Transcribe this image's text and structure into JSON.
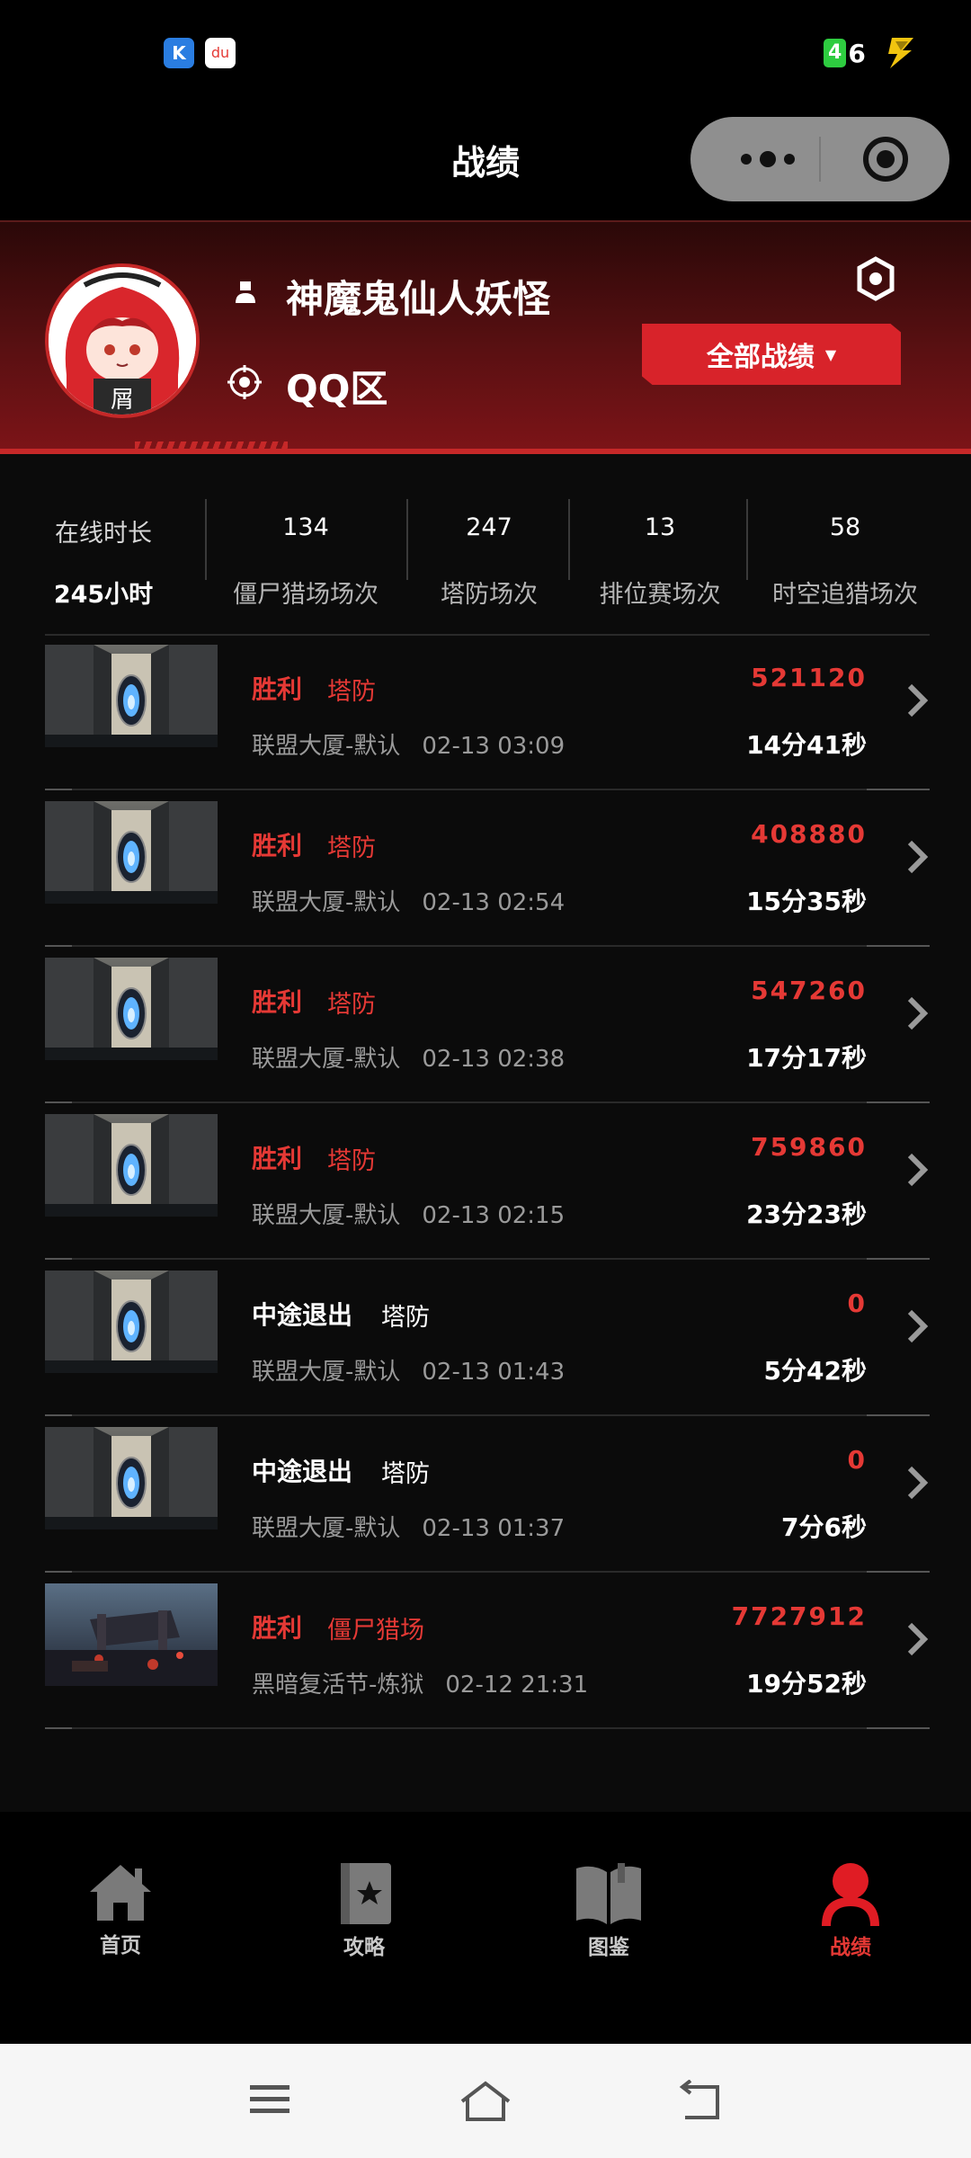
{
  "status_bar": {
    "network_badge": "4",
    "signal_text": "6",
    "app_icons": [
      "k-app-icon",
      "du-app-icon"
    ],
    "app1_text": "K",
    "app2_text": "du"
  },
  "header": {
    "title": "战绩"
  },
  "profile": {
    "username": "神魔鬼仙人妖怪",
    "zone": "QQ区",
    "filter_label": "全部战绩",
    "filter_arrow": "▼"
  },
  "stats": [
    {
      "value": "在线时长",
      "label": "245小时"
    },
    {
      "value": "134",
      "label": "僵尸猎场场次"
    },
    {
      "value": "247",
      "label": "塔防场次"
    },
    {
      "value": "13",
      "label": "排位赛场次"
    },
    {
      "value": "58",
      "label": "时空追猎场次"
    }
  ],
  "records": [
    {
      "result": "胜利",
      "mode": "塔防",
      "map": "联盟大厦-默认",
      "time": "02-13 03:09",
      "score": "521120",
      "duration": "14分41秒",
      "status": "win",
      "scene": "tower"
    },
    {
      "result": "胜利",
      "mode": "塔防",
      "map": "联盟大厦-默认",
      "time": "02-13 02:54",
      "score": "408880",
      "duration": "15分35秒",
      "status": "win",
      "scene": "tower"
    },
    {
      "result": "胜利",
      "mode": "塔防",
      "map": "联盟大厦-默认",
      "time": "02-13 02:38",
      "score": "547260",
      "duration": "17分17秒",
      "status": "win",
      "scene": "tower"
    },
    {
      "result": "胜利",
      "mode": "塔防",
      "map": "联盟大厦-默认",
      "time": "02-13 02:15",
      "score": "759860",
      "duration": "23分23秒",
      "status": "win",
      "scene": "tower"
    },
    {
      "result": "中途退出",
      "mode": "塔防",
      "map": "联盟大厦-默认",
      "time": "02-13 01:43",
      "score": "0",
      "duration": "5分42秒",
      "status": "quit",
      "scene": "tower"
    },
    {
      "result": "中途退出",
      "mode": "塔防",
      "map": "联盟大厦-默认",
      "time": "02-13 01:37",
      "score": "0",
      "duration": "7分6秒",
      "status": "quit",
      "scene": "tower"
    },
    {
      "result": "胜利",
      "mode": "僵尸猎场",
      "map": "黑暗复活节-炼狱",
      "time": "02-12 21:31",
      "score": "7727912",
      "duration": "19分52秒",
      "status": "win",
      "scene": "ruins"
    }
  ],
  "bottom_nav": [
    {
      "label": "首页",
      "icon": "home-icon",
      "active": false
    },
    {
      "label": "攻略",
      "icon": "guide-book-icon",
      "active": false
    },
    {
      "label": "图鉴",
      "icon": "open-book-icon",
      "active": false
    },
    {
      "label": "战绩",
      "icon": "profile-icon",
      "active": true
    }
  ],
  "colors": {
    "accent": "#e53935",
    "button": "#d8232a",
    "header_gradient_end": "#7e1418",
    "background": "#0b0b0b"
  }
}
